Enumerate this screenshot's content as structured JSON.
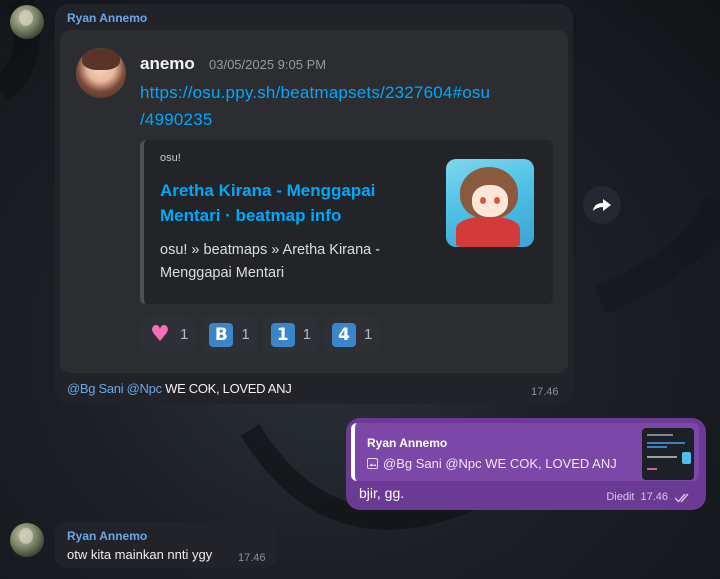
{
  "message1": {
    "sender": "Ryan Annemo",
    "time": "17.46",
    "discord": {
      "author": "anemo",
      "date": "03/05/2025 9:05 PM",
      "link_line1": "https://osu.ppy.sh/beatmapsets/2327604#osu",
      "link_line2": "/4990235",
      "embed": {
        "provider": "osu!",
        "title": "Aretha Kirana - Menggapai Mentari · beatmap info",
        "description": "osu! » beatmaps » Aretha Kirana - Menggapai Mentari"
      },
      "reactions": [
        {
          "emoji": "♥",
          "icon": "heart-icon",
          "count": "1"
        },
        {
          "emoji": "B",
          "icon": "b-button-icon",
          "count": "1"
        },
        {
          "emoji": "1",
          "icon": "keycap-1-icon",
          "count": "1"
        },
        {
          "emoji": "4",
          "icon": "keycap-4-icon",
          "count": "1"
        }
      ]
    },
    "caption": {
      "mention1": "@Bg Sani",
      "mention2": "@Npc",
      "text": "WE COK, LOVED ANJ"
    }
  },
  "message2": {
    "reply_to_name": "Ryan Annemo",
    "reply_to_text": "@Bg Sani @Npc WE COK, LOVED ANJ",
    "text": "bjir, gg.",
    "edited": "Diedit",
    "time": "17.46"
  },
  "message3": {
    "sender": "Ryan Annemo",
    "text": "otw kita mainkan nnti ygy",
    "time": "17.46"
  },
  "colors": {
    "incoming_bubble": "#212328",
    "outgoing_bubble": "#6a3a94",
    "link": "#00a8fc",
    "sender": "#6aa8e8"
  }
}
